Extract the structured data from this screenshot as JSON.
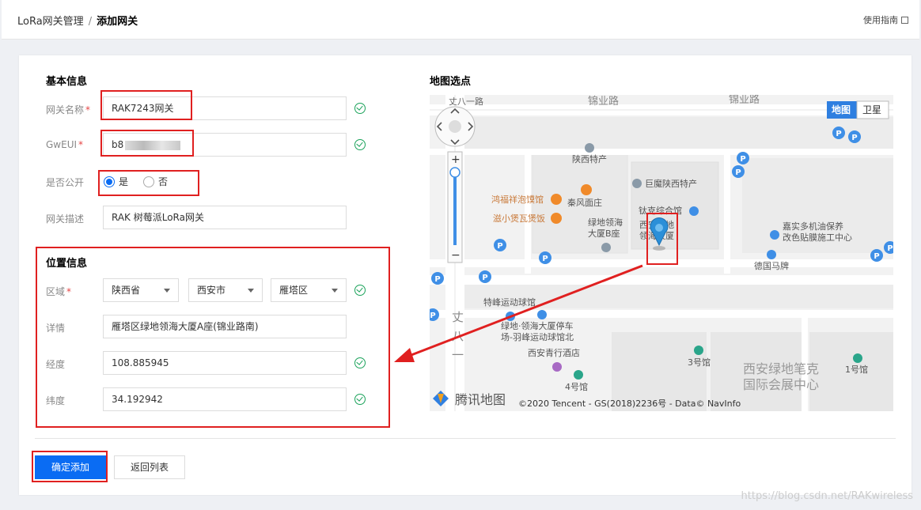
{
  "breadcrumb": {
    "parent": "LoRa网关管理",
    "separator": "/",
    "current": "添加网关"
  },
  "header": {
    "guide_label": "使用指南"
  },
  "basic": {
    "title": "基本信息",
    "name_label": "网关名称",
    "name_value": "RAK7243网关",
    "eui_label": "GwEUI",
    "eui_value": "b8",
    "public_label": "是否公开",
    "public_yes": "是",
    "public_no": "否",
    "desc_label": "网关描述",
    "desc_value": "RAK 树莓派LoRa网关",
    "required_mark": "*"
  },
  "location": {
    "title": "位置信息",
    "region_label": "区域",
    "province": "陕西省",
    "city": "西安市",
    "district": "雁塔区",
    "detail_label": "详情",
    "detail_value": "雁塔区绿地领海大厦A座(锦业路南)",
    "lng_label": "经度",
    "lng_value": "108.885945",
    "lat_label": "纬度",
    "lat_value": "34.192942"
  },
  "map": {
    "title": "地图选点",
    "type_map": "地图",
    "type_satellite": "卫星",
    "zoom_in": "+",
    "zoom_out": "−",
    "brand": "腾讯地图",
    "copyright": "©2020 Tencent - GS(2018)2236号 - Data© NavInfo",
    "labels": {
      "road_top1": "丈八一路",
      "road_top2": "锦业路",
      "road_top3": "锦业路",
      "shaanxi_tech": "陕西特产",
      "jumo": "巨魔陕西特产",
      "hongfu": "鸿福祥泡馍馆",
      "qinfeng": "秦风面庄",
      "zixiao": "滋小煲瓦煲饭",
      "lvdi_b": "绿地领海\n大厦B座",
      "taike": "钛克综合馆",
      "xian_lvdi": "西安绿地\n领海大厦",
      "jiashi": "嘉实多机油保养\n改色贴膜施工中心",
      "deguo": "德国马牌",
      "tefeng": "特峰运动球馆",
      "lvdi_park": "绿地·领海大厦停车\n场-羽峰运动球馆北",
      "qingxing": "西安青行酒店",
      "hall3": "3号馆",
      "hall4": "4号馆",
      "hall1": "1号馆",
      "expo": "西安绿地笔克\n国际会展中心",
      "zhangba": "丈\n八\n一\n路"
    }
  },
  "actions": {
    "confirm": "确定添加",
    "back": "返回列表"
  },
  "watermark": "https://blog.csdn.net/RAKwireless",
  "colors": {
    "primary": "#0a6cf3",
    "success": "#1aa25a",
    "annotation": "#e02020"
  }
}
